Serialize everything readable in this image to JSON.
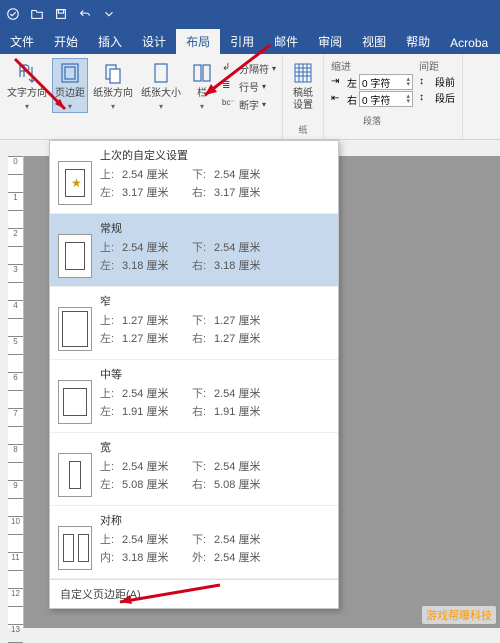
{
  "titlebar": {},
  "tabs": {
    "file": "文件",
    "home": "开始",
    "insert": "插入",
    "design": "设计",
    "layout": "布局",
    "references": "引用",
    "mail": "邮件",
    "review": "审阅",
    "view": "视图",
    "help": "帮助",
    "acrobat": "Acroba"
  },
  "ribbon": {
    "text_direction": "文字方向",
    "margins": "页边距",
    "orientation": "纸张方向",
    "size": "纸张大小",
    "columns": "栏",
    "breaks": "分隔符",
    "line_numbers": "行号",
    "hyphenation": "断字",
    "manuscript": "稿纸\n设置",
    "manuscript_group": "纸",
    "indent_header": "缩进",
    "indent_left_label": "左",
    "indent_right_label": "右",
    "indent_value": "0 字符",
    "spacing_header": "间距",
    "spacing_before": "段前",
    "spacing_after": "段后",
    "paragraph_group": "段落"
  },
  "margins_menu": {
    "last_custom": {
      "title": "上次的自定义设置",
      "top_k": "上:",
      "top_v": "2.54 厘米",
      "bottom_k": "下:",
      "bottom_v": "2.54 厘米",
      "left_k": "左:",
      "left_v": "3.17 厘米",
      "right_k": "右:",
      "right_v": "3.17 厘米"
    },
    "normal": {
      "title": "常规",
      "top_k": "上:",
      "top_v": "2.54 厘米",
      "bottom_k": "下:",
      "bottom_v": "2.54 厘米",
      "left_k": "左:",
      "left_v": "3.18 厘米",
      "right_k": "右:",
      "right_v": "3.18 厘米"
    },
    "narrow": {
      "title": "窄",
      "top_k": "上:",
      "top_v": "1.27 厘米",
      "bottom_k": "下:",
      "bottom_v": "1.27 厘米",
      "left_k": "左:",
      "left_v": "1.27 厘米",
      "right_k": "右:",
      "right_v": "1.27 厘米"
    },
    "moderate": {
      "title": "中等",
      "top_k": "上:",
      "top_v": "2.54 厘米",
      "bottom_k": "下:",
      "bottom_v": "2.54 厘米",
      "left_k": "左:",
      "left_v": "1.91 厘米",
      "right_k": "右:",
      "right_v": "1.91 厘米"
    },
    "wide": {
      "title": "宽",
      "top_k": "上:",
      "top_v": "2.54 厘米",
      "bottom_k": "下:",
      "bottom_v": "2.54 厘米",
      "left_k": "左:",
      "left_v": "5.08 厘米",
      "right_k": "右:",
      "right_v": "5.08 厘米"
    },
    "mirrored": {
      "title": "对称",
      "top_k": "上:",
      "top_v": "2.54 厘米",
      "bottom_k": "下:",
      "bottom_v": "2.54 厘米",
      "in_k": "内:",
      "in_v": "3.18 厘米",
      "out_k": "外:",
      "out_v": "2.54 厘米"
    },
    "custom": "自定义页边距(A)..."
  },
  "watermark": "游戏帮曝科技"
}
